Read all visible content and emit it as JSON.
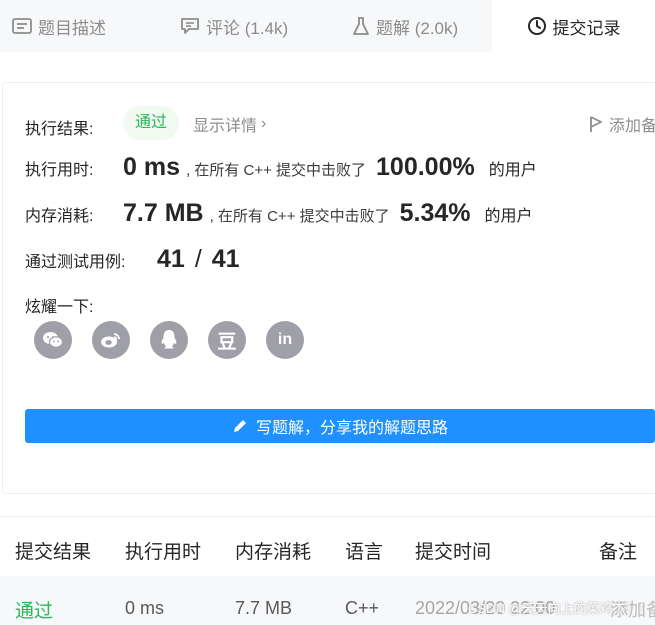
{
  "tabs": [
    {
      "label": "题目描述",
      "icon": "description-icon"
    },
    {
      "label": "评论 (1.4k)",
      "icon": "comment-icon"
    },
    {
      "label": "题解 (2.0k)",
      "icon": "flask-icon"
    },
    {
      "label": "提交记录",
      "icon": "clock-icon"
    }
  ],
  "result": {
    "status_label": "执行结果:",
    "status": "通过",
    "details_link": "显示详情",
    "add_note": "添加备注",
    "runtime_label": "执行用时:",
    "runtime_value": "0 ms",
    "runtime_text": ", 在所有 C++ 提交中击败了",
    "runtime_percent": "100.00%",
    "runtime_suffix": "的用户",
    "memory_label": "内存消耗:",
    "memory_value": "7.7 MB",
    "memory_text": ", 在所有 C++ 提交中击败了",
    "memory_percent": "5.34%",
    "memory_suffix": "的用户",
    "tests_label": "通过测试用例:",
    "tests_passed": "41",
    "tests_sep": "/",
    "tests_total": "41",
    "share_label": "炫耀一下:",
    "share_icons": [
      "wechat-icon",
      "weibo-icon",
      "qq-icon",
      "douban-icon",
      "linkedin-icon"
    ],
    "cta": "写题解，分享我的解题思路"
  },
  "table": {
    "headers": [
      "提交结果",
      "执行用时",
      "内存消耗",
      "语言",
      "提交时间",
      "备注"
    ],
    "rows": [
      {
        "result": "通过",
        "runtime": "0 ms",
        "memory": "7.7 MB",
        "language": "C++",
        "time": "2022/03/20 22:00",
        "note": "添加备注"
      }
    ]
  },
  "watermark": "CSDN @天天向上的菜鸡杰！！"
}
